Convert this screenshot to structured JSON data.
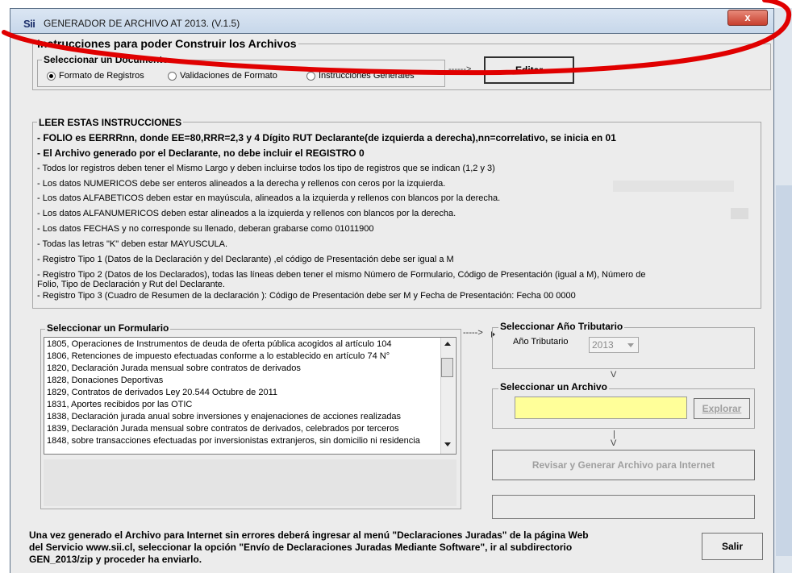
{
  "window": {
    "title": "GENERADOR DE ARCHIVO AT 2013. (V.1.5)",
    "logo": "Sii",
    "close_glyph": "x"
  },
  "construir": {
    "legend": "Instrucciones para poder Construir los Archivos",
    "doc_legend": "Seleccionar un Documento",
    "options": [
      "Formato de Registros",
      "Validaciones de Formato",
      "Instrucciones Generales"
    ],
    "selected_option": "Formato de Registros",
    "editar_label": "Editar",
    "arrow": "------>"
  },
  "instrucciones": {
    "legend": "LEER ESTAS INSTRUCCIONES",
    "lines": [
      "- FOLIO es EERRRnn, donde EE=80,RRR=2,3 y 4 Dígito RUT Declarante(de izquierda a derecha),nn=correlativo, se inicia en 01",
      "- El Archivo generado por el Declarante, no debe incluir el REGISTRO 0",
      "- Todos lor registros deben tener el Mismo Largo y deben incluirse todos los tipo de registros que se indican (1,2 y 3)",
      "- Los datos NUMERICOS  debe ser enteros alineados a la derecha y rellenos con ceros por la izquierda.",
      "- Los datos ALFABETICOS deben estar en mayúscula, alineados a la izquierda y rellenos con blancos por la derecha.",
      "- Los datos ALFANUMERICOS deben estar alineados a la izquierda y rellenos con blancos por la derecha.",
      "- Los datos FECHAS y no corresponde su llenado, deberan grabarse como  01011900",
      "- Todas las letras \"K\" deben estar MAYUSCULA.",
      "- Registro Tipo 1 (Datos de la Declaración y del Declarante) ,el código de Presentación debe ser igual a M",
      "- Registro Tipo 2 (Datos de los Declarados), todas las líneas deben tener el mismo Número de Formulario, Código de Presentación (igual a M), Número de",
      "Folio, Tipo de Declaración y Rut del Declarante.",
      "- Registro Tipo 3 (Cuadro de Resumen de la declaración ): Código de Presentación debe ser M y Fecha de Presentación: Fecha 00  0000"
    ]
  },
  "formulario": {
    "legend": "Seleccionar un Formulario",
    "items": [
      "1805, Operaciones de Instrumentos de deuda de oferta pública acogidos al artículo 104",
      "1806, Retenciones de impuesto efectuadas conforme a lo establecido en artículo 74 N°",
      "1820, Declaración Jurada mensual sobre contratos de derivados",
      "1828, Donaciones Deportivas",
      "1829, Contratos de derivados Ley 20.544 Octubre de 2011",
      "1831, Aportes recibidos por las OTIC",
      "1838, Declaración jurada anual sobre inversiones y enajenaciones de acciones realizadas",
      "1839, Declaración Jurada mensual sobre contratos de derivados, celebrados por terceros",
      "1848, sobre transacciones efectuadas por inversionistas extranjeros, sin domicilio ni residencia"
    ],
    "arrow": "----->"
  },
  "anio": {
    "legend": "Seleccionar Año Tributario",
    "label": "Año Tributario",
    "value": "2013"
  },
  "archivo": {
    "legend": "Seleccionar un Archivo",
    "value": "",
    "explorar_label": "Explorar"
  },
  "generar": {
    "label": "Revisar y Generar Archivo para Internet",
    "status": ""
  },
  "footer": {
    "lines": [
      "Una vez generado el Archivo para Internet sin errores deberá ingresar al menú \"Declaraciones Juradas\" de  la página Web",
      "del Servicio www.sii.cl, seleccionar la opción \"Envío de Declaraciones Juradas Mediante Software\", ir al subdirectorio",
      "GEN_2013/zip y proceder ha enviarlo."
    ],
    "salir_label": "Salir"
  },
  "connector": {
    "down": "V",
    "pipe": "|"
  },
  "colors": {
    "annotation": "#e00000",
    "input_bg": "#ffff99",
    "window_bg": "#ececec"
  }
}
